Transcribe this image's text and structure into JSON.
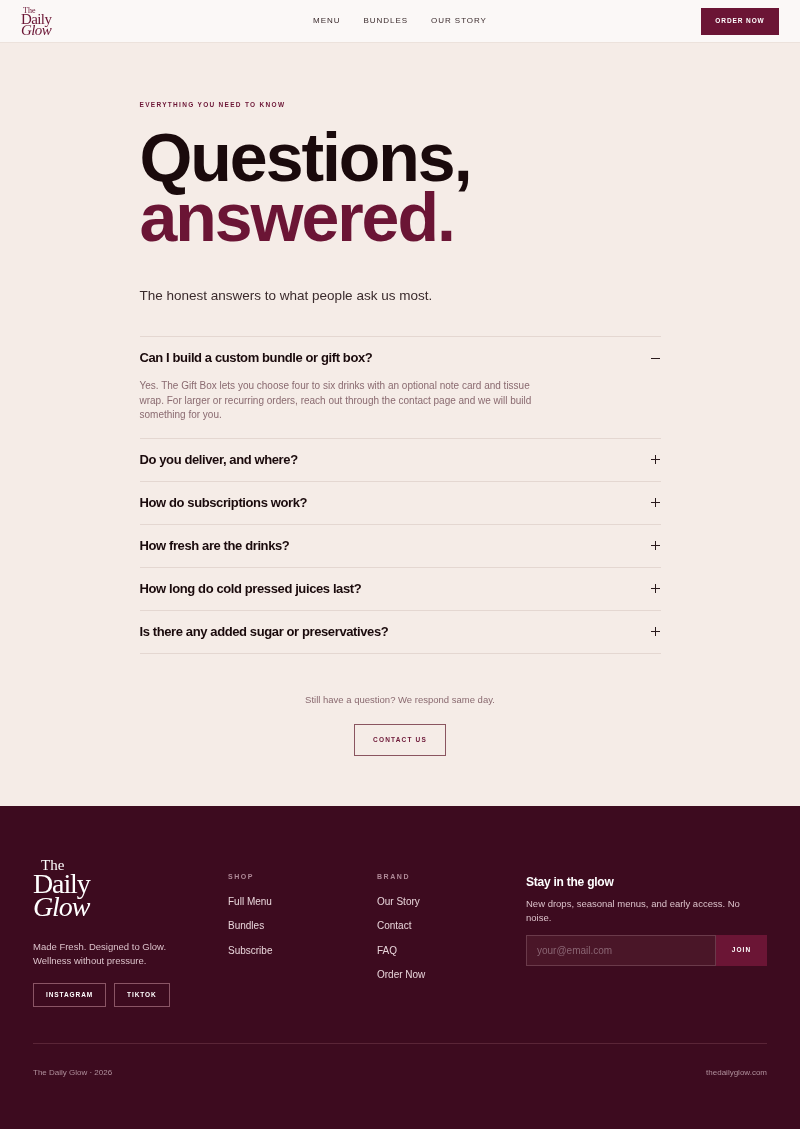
{
  "header": {
    "logo": {
      "lines": [
        "The",
        "Daily",
        "Glow"
      ]
    },
    "nav": [
      {
        "label": "MENU"
      },
      {
        "label": "BUNDLES"
      },
      {
        "label": "OUR STORY"
      }
    ],
    "cta": "ORDER NOW"
  },
  "hero": {
    "eyebrow": "EVERYTHING YOU NEED TO KNOW",
    "heading": [
      "Questions,",
      "answered."
    ],
    "subtitle": "The honest answers to what people ask us most."
  },
  "faq": [
    {
      "question": "Can I build a custom bundle or gift box?",
      "expanded": true,
      "answer": "Yes. The Gift Box lets you choose four to six drinks with an optional note card and tissue wrap. For larger or recurring orders, reach out through the contact page and we will build something for you."
    },
    {
      "question": "Do you deliver, and where?",
      "expanded": false
    },
    {
      "question": "How do subscriptions work?",
      "expanded": false
    },
    {
      "question": "How fresh are the drinks?",
      "expanded": false
    },
    {
      "question": "How long do cold pressed juices last?",
      "expanded": false
    },
    {
      "question": "Is there any added sugar or preservatives?",
      "expanded": false
    }
  ],
  "contact": {
    "prompt": "Still have a question? We respond same day.",
    "button": "CONTACT US"
  },
  "footer": {
    "logo": {
      "lines": [
        "The",
        "Daily",
        "Glow"
      ]
    },
    "tagline": "Made Fresh. Designed to Glow. Wellness without pressure.",
    "social": [
      "INSTAGRAM",
      "TIKTOK"
    ],
    "columns": [
      {
        "heading": "SHOP",
        "links": [
          "Full Menu",
          "Bundles",
          "Subscribe"
        ]
      },
      {
        "heading": "BRAND",
        "links": [
          "Our Story",
          "Contact",
          "FAQ",
          "Order Now"
        ]
      }
    ],
    "newsletter": {
      "title": "Stay in the glow",
      "text": "New drops, seasonal menus, and early access. No noise.",
      "placeholder": "your@email.com",
      "button": "JOIN"
    },
    "copyright": "The Daily Glow · 2026",
    "domain": "thedailyglow.com"
  }
}
